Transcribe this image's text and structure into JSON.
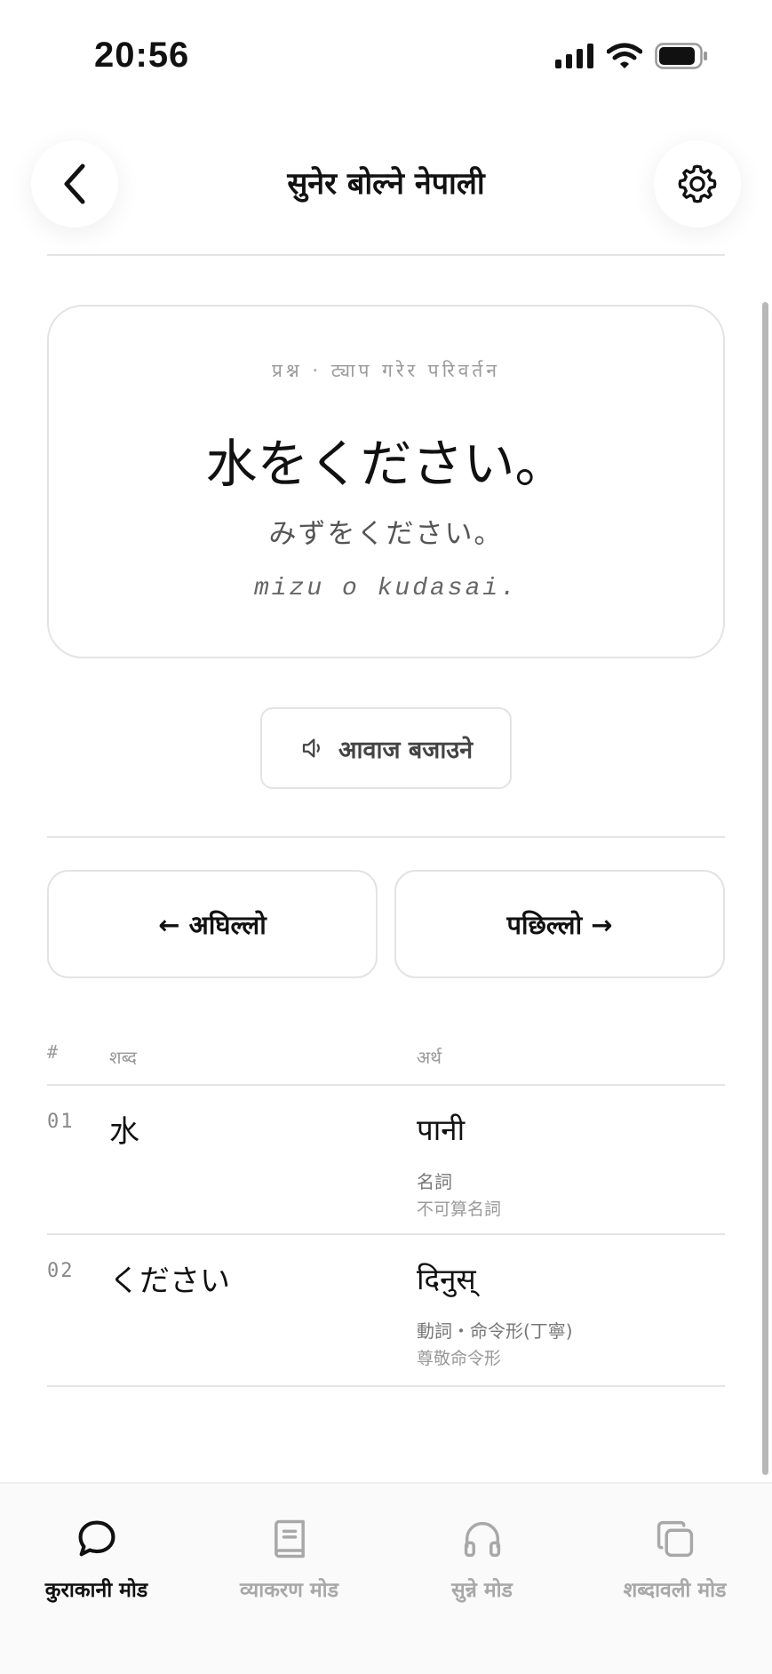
{
  "status": {
    "time": "20:56"
  },
  "header": {
    "title": "सुनेर बोल्ने नेपाली"
  },
  "question": {
    "meta": "प्रश्न · ट्याप गरेर परिवर्तन",
    "main": "水をください。",
    "kana": "みずをください。",
    "romaji": "mizu o kudasai."
  },
  "sound_button": {
    "label": "आवाज बजाउने"
  },
  "navigation": {
    "prev_label": "← अघिल्लो",
    "next_label": "पछिल्लो →"
  },
  "vocab": {
    "headers": {
      "num": "#",
      "word": "शब्द",
      "meaning": "अर्थ"
    },
    "rows": [
      {
        "num": "01",
        "word": "水",
        "meaning": "पानी",
        "pos": "名詞",
        "pos_detail": "不可算名詞"
      },
      {
        "num": "02",
        "word": "ください",
        "meaning": "दिनुस्",
        "pos": "動詞・命令形(丁寧)",
        "pos_detail": "尊敬命令形"
      }
    ]
  },
  "tabs": [
    {
      "label": "कुराकानी मोड",
      "icon": "chat-bubble-icon",
      "active": true
    },
    {
      "label": "व्याकरण मोड",
      "icon": "book-icon",
      "active": false
    },
    {
      "label": "सुन्ने मोड",
      "icon": "headphones-icon",
      "active": false
    },
    {
      "label": "शब्दावली मोड",
      "icon": "cards-icon",
      "active": false
    }
  ],
  "colors": {
    "active": "#111111",
    "inactive": "#a8a8a8",
    "border": "#e3e3e3"
  }
}
